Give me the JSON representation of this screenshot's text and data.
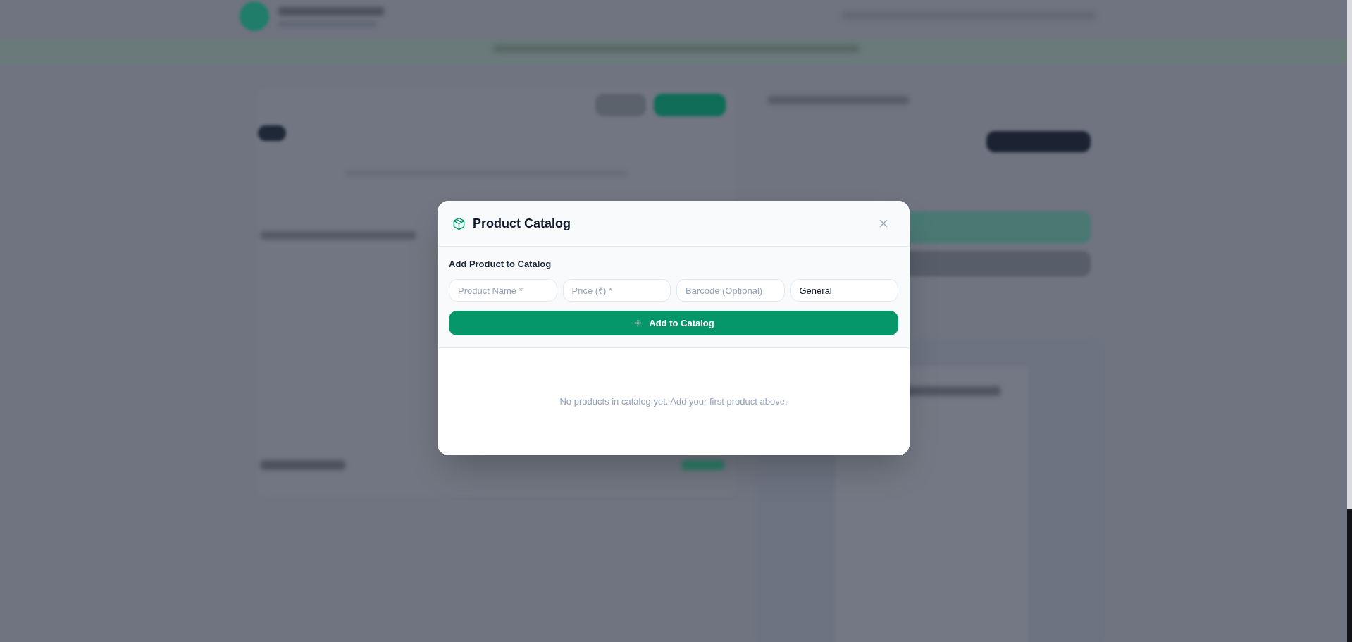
{
  "dialog": {
    "title": "Product Catalog",
    "form": {
      "heading": "Add Product to Catalog",
      "fields": [
        {
          "placeholder": "Product Name *"
        },
        {
          "placeholder": "Price (₹) *"
        },
        {
          "placeholder": "Barcode (Optional)"
        },
        {
          "value": "General"
        }
      ],
      "submit_button": "Add to Catalog"
    },
    "empty_message": "No products in catalog yet. Add your first product above."
  }
}
